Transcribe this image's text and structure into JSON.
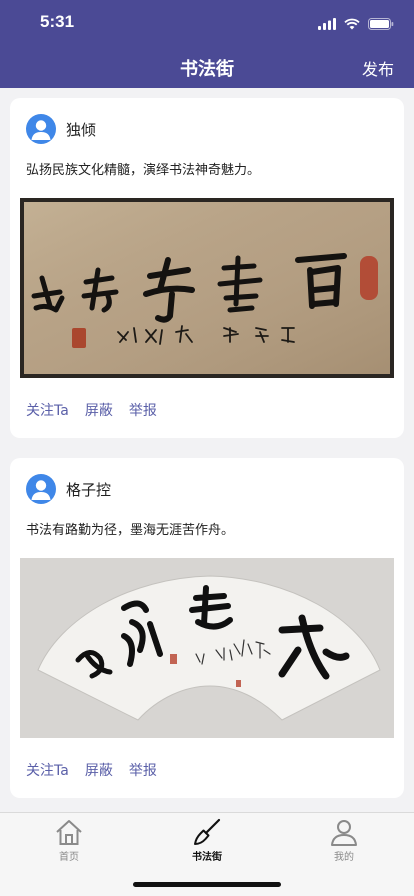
{
  "status_bar": {
    "time": "5:31"
  },
  "nav": {
    "title": "书法街",
    "publish_label": "发布"
  },
  "posts": [
    {
      "username": "独倾",
      "text": "弘扬民族文化精髓，演绎书法神奇魅力。",
      "actions": {
        "follow": "关注Ta",
        "block": "屏蔽",
        "report": "举报"
      }
    },
    {
      "username": "格子控",
      "text": "书法有路勤为径，墨海无涯苦作舟。",
      "actions": {
        "follow": "关注Ta",
        "block": "屏蔽",
        "report": "举报"
      }
    }
  ],
  "tabbar": {
    "items": [
      {
        "label": "首页",
        "icon": "home-icon"
      },
      {
        "label": "书法街",
        "icon": "brush-icon",
        "active": true
      },
      {
        "label": "我的",
        "icon": "user-icon"
      }
    ]
  },
  "colors": {
    "header_bg": "#4b4a95",
    "action_text": "#5a5fa8",
    "avatar_bg": "#3f87e8"
  }
}
